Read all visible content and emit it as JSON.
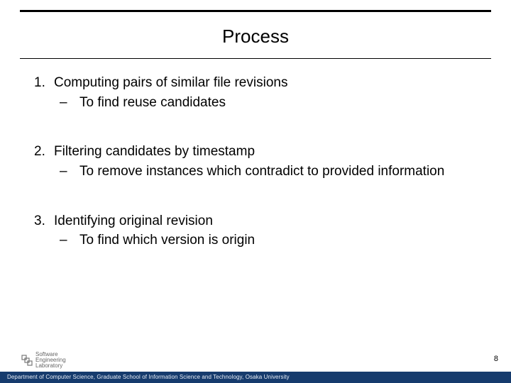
{
  "title": "Process",
  "items": [
    {
      "num": "1.",
      "text": "Computing pairs of similar file revisions",
      "sub": {
        "dash": "–",
        "text": "To find reuse candidates"
      }
    },
    {
      "num": "2.",
      "text": "Filtering candidates by timestamp",
      "sub": {
        "dash": "–",
        "text": "To remove instances which contradict to provided information"
      }
    },
    {
      "num": "3.",
      "text": "Identifying original revision",
      "sub": {
        "dash": "–",
        "text": "To find which version is origin"
      }
    }
  ],
  "page_number": "8",
  "footer": "Department of Computer Science, Graduate School of Information Science and Technology, Osaka University",
  "logo": {
    "line1": "Software",
    "line2": "Engineering",
    "line3": "Laboratory"
  }
}
